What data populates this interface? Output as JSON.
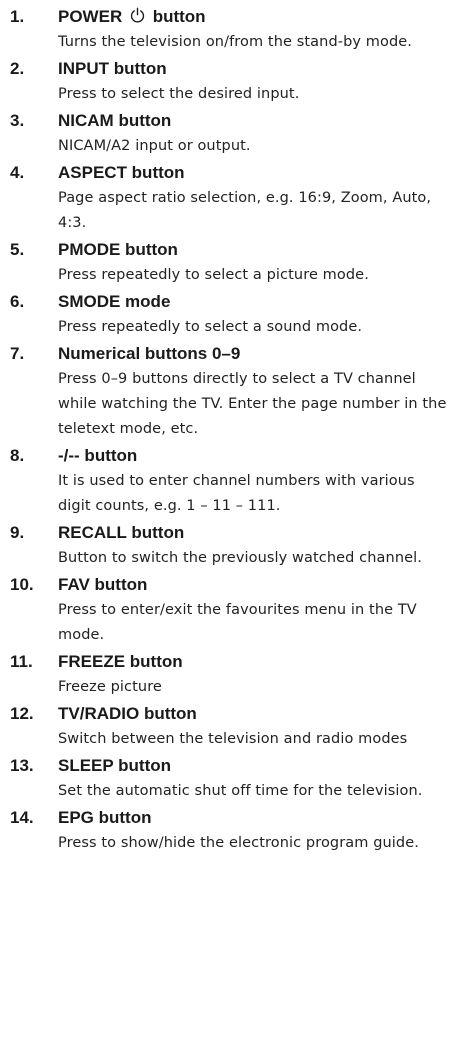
{
  "items": [
    {
      "number": "1.",
      "title_before": "POWER",
      "title_after": "button",
      "has_power_icon": true,
      "description": "Turns the television on/from the stand-by mode."
    },
    {
      "number": "2.",
      "title": "INPUT button",
      "description": "Press to select the desired input."
    },
    {
      "number": "3.",
      "title": "NICAM button",
      "description": "NICAM/A2 input or output."
    },
    {
      "number": "4.",
      "title": "ASPECT button",
      "description": "Page aspect ratio selection, e.g. 16:9, Zoom, Auto, 4:3."
    },
    {
      "number": "5.",
      "title": "PMODE button",
      "description": "Press repeatedly to select a picture mode."
    },
    {
      "number": "6.",
      "title": "SMODE mode",
      "description": "Press repeatedly to select a sound mode."
    },
    {
      "number": "7.",
      "title": "Numerical buttons 0–9",
      "description": "Press 0–9 buttons directly to select a TV channel while watching the TV. Enter the page number in the teletext mode, etc."
    },
    {
      "number": "8.",
      "title": "-/-- button",
      "description": "It is used to enter channel numbers with various digit counts, e.g. 1 – 11 – 111."
    },
    {
      "number": "9.",
      "title": "RECALL button",
      "description": "Button to switch the previously watched channel."
    },
    {
      "number": "10.",
      "title": "FAV button",
      "description": "Press to enter/exit the favourites menu in the TV mode."
    },
    {
      "number": "11.",
      "title": "FREEZE button",
      "description": "Freeze picture"
    },
    {
      "number": "12.",
      "title": "TV/RADIO button",
      "description": "Switch between the television and radio modes"
    },
    {
      "number": "13.",
      "title": "SLEEP button",
      "description": "Set the automatic shut off time for the television."
    },
    {
      "number": "14.",
      "title": "EPG button",
      "description": "Press to show/hide the electronic program guide."
    }
  ]
}
